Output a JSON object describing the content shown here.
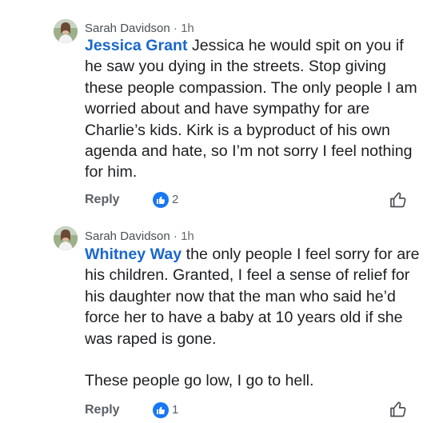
{
  "comments": [
    {
      "author": "Sarah Davidson",
      "time": "1h",
      "mention": "Jessica Grant",
      "paragraphs": [
        " Jessica he would spit on you if he saw you dying in the streets. Stop giving these people compassion. The only people I am worried about and have sympathy for are Charlie’s kids. Kirk is a byproduct of his own agenda and hate, so I’m not sorry I feel nothing for him."
      ],
      "reply_label": "Reply",
      "reaction_count": "2",
      "reaction_icon": "like-icon",
      "like_icon": "thumbs-up-outline-icon"
    },
    {
      "author": "Sarah Davidson",
      "time": "1h",
      "mention": "Whitney Way",
      "paragraphs": [
        " the only people I feel sorry for are his children. Granted, I feel a sense of relief for his daughter now that the man who said he’d force her to have a baby at 10 years old if she was raped is gone.",
        "These people go low, I go to hell."
      ],
      "reply_label": "Reply",
      "reaction_count": "1",
      "reaction_icon": "like-icon",
      "like_icon": "thumbs-up-outline-icon"
    }
  ],
  "separator": "·",
  "colors": {
    "mention": "#1b67cc",
    "reaction_badge": "#1877f2",
    "secondary_text": "#65676b"
  }
}
